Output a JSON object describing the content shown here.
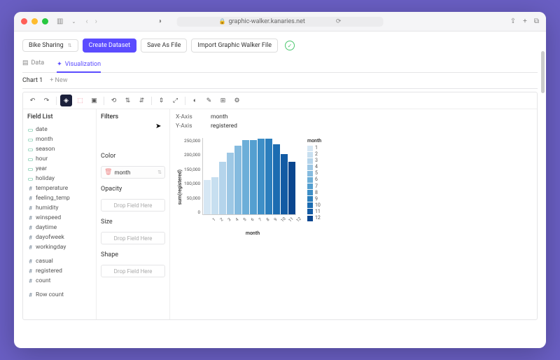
{
  "browser": {
    "url": "graphic-walker.kanaries.net"
  },
  "top": {
    "dataset": "Bike Sharing",
    "create": "Create Dataset",
    "save": "Save As File",
    "import": "Import Graphic Walker File"
  },
  "tabs": {
    "data": "Data",
    "viz": "Visualization"
  },
  "chartTabs": {
    "chart1": "Chart 1",
    "new": "+ New"
  },
  "fieldList": {
    "title": "Field List",
    "dims": [
      "date",
      "month",
      "season",
      "hour",
      "year",
      "holiday"
    ],
    "meas": [
      "temperature",
      "feeling_temp",
      "humidity",
      "winspeed",
      "daytime",
      "dayofweek",
      "workingday"
    ],
    "agg": [
      "casual",
      "registered",
      "count"
    ],
    "row": [
      "Row count"
    ]
  },
  "shelves": {
    "filters": "Filters",
    "color": "Color",
    "colorVal": "month",
    "opacity": "Opacity",
    "size": "Size",
    "shape": "Shape",
    "drop": "Drop Field Here"
  },
  "axes": {
    "x": "X-Axis",
    "xv": "month",
    "y": "Y-Axis",
    "yv": "registered"
  },
  "chart_data": {
    "type": "bar",
    "categories": [
      "1",
      "2",
      "3",
      "4",
      "5",
      "6",
      "7",
      "8",
      "9",
      "10",
      "11",
      "12"
    ],
    "values": [
      125000,
      135000,
      190000,
      225000,
      250000,
      270000,
      270000,
      275000,
      275000,
      255000,
      220000,
      190000
    ],
    "title": "",
    "xlabel": "month",
    "ylabel": "sum(registered)",
    "ylim": [
      0,
      280000
    ],
    "yticks": [
      "250,000",
      "200,000",
      "150,000",
      "100,000",
      "50,000",
      "0"
    ],
    "legend_title": "month",
    "colors": [
      "#d6e7f4",
      "#c7dff0",
      "#b4d4eb",
      "#9ec8e5",
      "#85bbdf",
      "#6caed8",
      "#549fd0",
      "#3e8fc7",
      "#2b7ebd",
      "#1c6cb1",
      "#135ba4",
      "#0a468f"
    ]
  }
}
